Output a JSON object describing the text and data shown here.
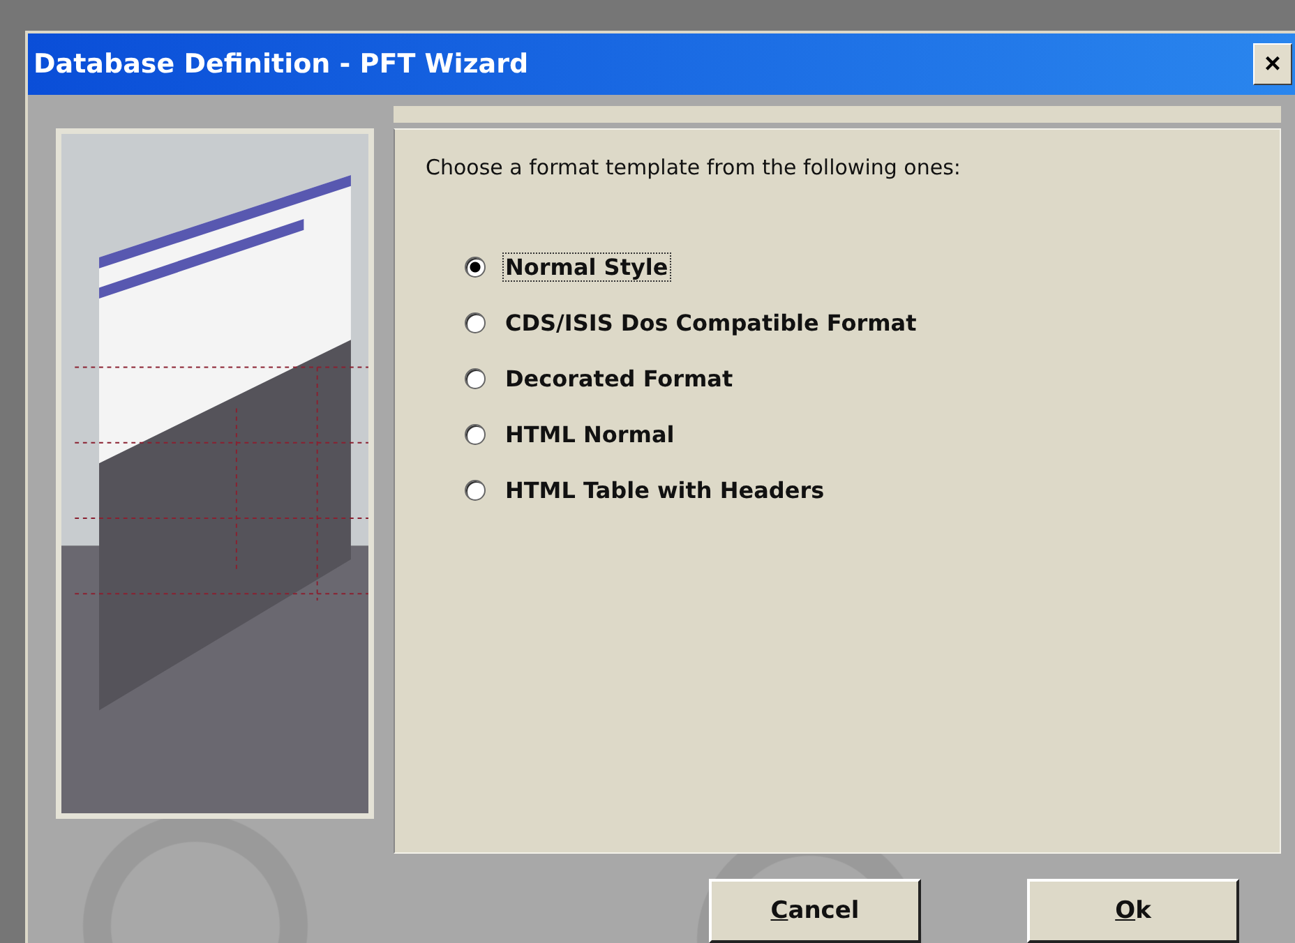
{
  "window": {
    "title": "Database Definition - PFT Wizard",
    "close": "×"
  },
  "prompt": "Choose a format template from the following ones:",
  "options": [
    {
      "label": "Normal Style",
      "selected": true
    },
    {
      "label": "CDS/ISIS Dos Compatible Format",
      "selected": false
    },
    {
      "label": "Decorated Format",
      "selected": false
    },
    {
      "label": "HTML Normal",
      "selected": false
    },
    {
      "label": "HTML Table with Headers",
      "selected": false
    }
  ],
  "buttons": [
    "Cancel",
    "Ok"
  ]
}
